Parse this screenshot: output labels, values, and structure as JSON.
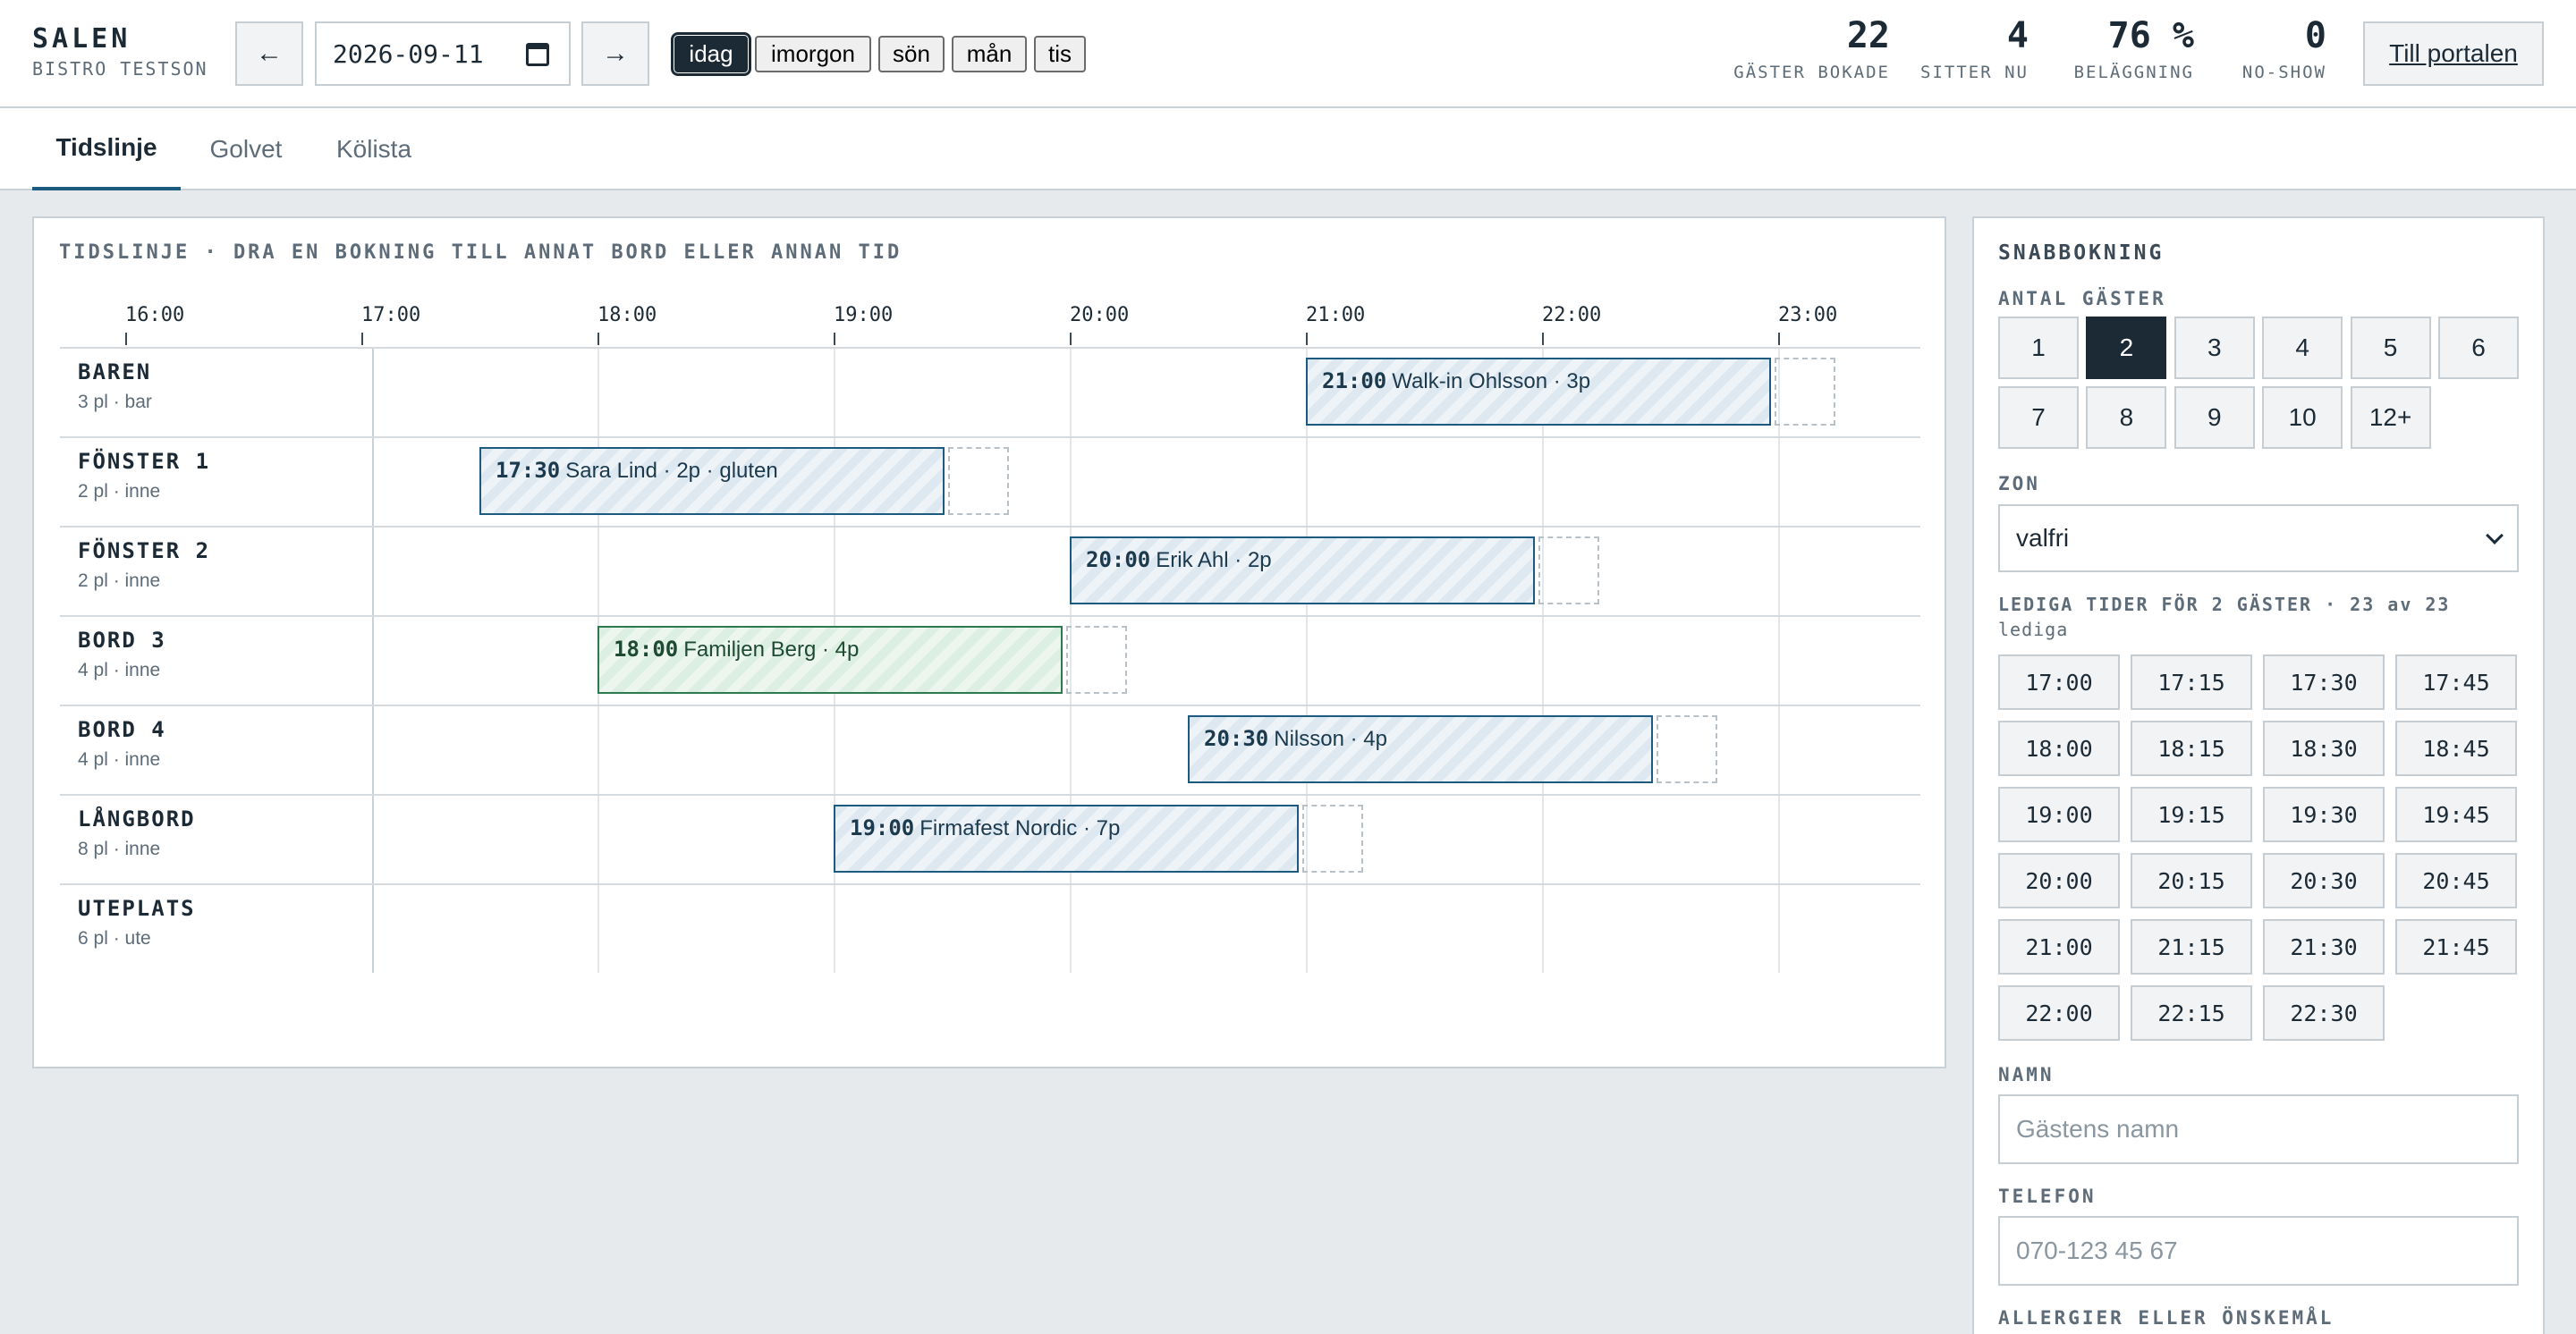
{
  "header": {
    "title": "SALEN",
    "subtitle": "BISTRO TESTSON",
    "date_value": "2026-09-11",
    "quick_days": [
      "idag",
      "imorgon",
      "sön",
      "mån",
      "tis"
    ],
    "stats": [
      {
        "value": "22",
        "label": "GÄSTER BOKADE"
      },
      {
        "value": "4",
        "label": "SITTER NU"
      },
      {
        "value": "76 %",
        "label": "BELÄGGNING"
      },
      {
        "value": "0",
        "label": "NO-SHOW"
      }
    ],
    "portal_label": "Till portalen"
  },
  "tabs": [
    "Tidslinje",
    "Golvet",
    "Kölista"
  ],
  "timeline": {
    "title": "TIDSLINJE · DRA EN BOKNING TILL ANNAT BORD ELLER ANNAN TID",
    "hours": [
      "16:00",
      "17:00",
      "18:00",
      "19:00",
      "20:00",
      "21:00",
      "22:00",
      "23:00"
    ],
    "tables": [
      {
        "name": "BAREN",
        "sub": "3 pl · bar"
      },
      {
        "name": "FÖNSTER 1",
        "sub": "2 pl · inne"
      },
      {
        "name": "FÖNSTER 2",
        "sub": "2 pl · inne"
      },
      {
        "name": "BORD 3",
        "sub": "4 pl · inne"
      },
      {
        "name": "BORD 4",
        "sub": "4 pl · inne"
      },
      {
        "name": "LÅNGBORD",
        "sub": "8 pl · inne"
      },
      {
        "name": "UTEPLATS",
        "sub": "6 pl · ute"
      }
    ],
    "bookings": [
      {
        "table": 0,
        "time": "21:00",
        "text": "Walk-in Ohlsson · 3p",
        "status": "booked"
      },
      {
        "table": 1,
        "time": "17:30",
        "text": "Sara Lind · 2p · gluten",
        "status": "booked"
      },
      {
        "table": 2,
        "time": "20:00",
        "text": "Erik Ahl · 2p",
        "status": "booked"
      },
      {
        "table": 3,
        "time": "18:00",
        "text": "Familjen Berg · 4p",
        "status": "seated"
      },
      {
        "table": 4,
        "time": "20:30",
        "text": "Nilsson · 4p",
        "status": "booked"
      },
      {
        "table": 5,
        "time": "19:00",
        "text": "Firmafest Nordic · 7p",
        "status": "booked"
      }
    ]
  },
  "quickbook": {
    "title": "SNABBOKNING",
    "guests_label": "ANTAL GÄSTER",
    "guest_options": [
      "1",
      "2",
      "3",
      "4",
      "5",
      "6",
      "7",
      "8",
      "9",
      "10",
      "12+"
    ],
    "selected_guests": "2",
    "zone_label": "ZON",
    "zone_value": "valfri",
    "slots_label_line1": "LEDIGA TIDER FÖR 2 GÄSTER · 23 av 23",
    "slots_label_line2": "lediga",
    "slots": [
      "17:00",
      "17:15",
      "17:30",
      "17:45",
      "18:00",
      "18:15",
      "18:30",
      "18:45",
      "19:00",
      "19:15",
      "19:30",
      "19:45",
      "20:00",
      "20:15",
      "20:30",
      "20:45",
      "21:00",
      "21:15",
      "21:30",
      "21:45",
      "22:00",
      "22:15",
      "22:30"
    ],
    "name_label": "NAMN",
    "name_placeholder": "Gästens namn",
    "phone_label": "TELEFON",
    "phone_placeholder": "070-123 45 67",
    "allergy_label": "ALLERGIER ELLER ÖNSKEMÅL"
  }
}
